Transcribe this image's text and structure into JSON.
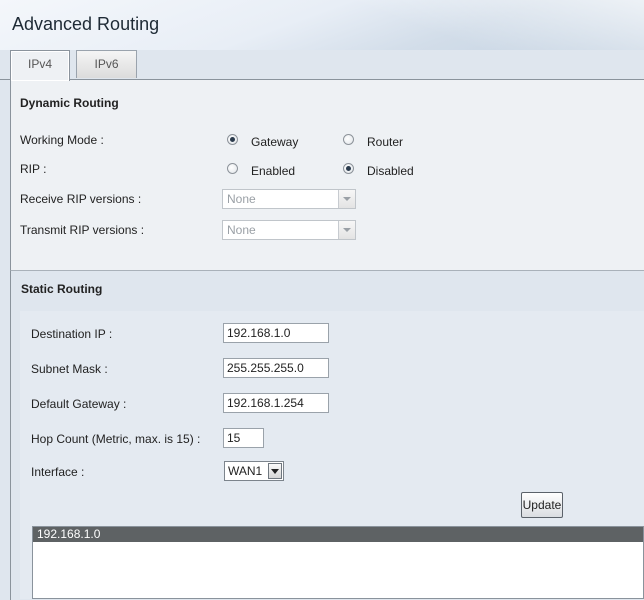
{
  "page": {
    "title": "Advanced Routing"
  },
  "tabs": [
    {
      "label": "IPv4"
    },
    {
      "label": "IPv6"
    }
  ],
  "dynamic_routing": {
    "title": "Dynamic Routing",
    "working_mode": {
      "label": "Working Mode :",
      "options": [
        "Gateway",
        "Router"
      ],
      "selected": "Gateway"
    },
    "rip": {
      "label": "RIP :",
      "options": [
        "Enabled",
        "Disabled"
      ],
      "selected": "Disabled"
    },
    "receive_rip_versions": {
      "label": "Receive RIP versions :",
      "value": "None"
    },
    "transmit_rip_versions": {
      "label": "Transmit RIP versions :",
      "value": "None"
    }
  },
  "static_routing": {
    "title": "Static Routing",
    "destination_ip": {
      "label": "Destination IP :",
      "value": "192.168.1.0"
    },
    "subnet_mask": {
      "label": "Subnet Mask :",
      "value": "255.255.255.0"
    },
    "default_gateway": {
      "label": "Default Gateway :",
      "value": "192.168.1.254"
    },
    "hop_count": {
      "label": "Hop Count (Metric, max. is 15) :",
      "value": "15"
    },
    "interface": {
      "label": "Interface :",
      "value": "WAN1"
    },
    "update_button": "Update",
    "route_list": [
      "192.168.1.0"
    ]
  }
}
